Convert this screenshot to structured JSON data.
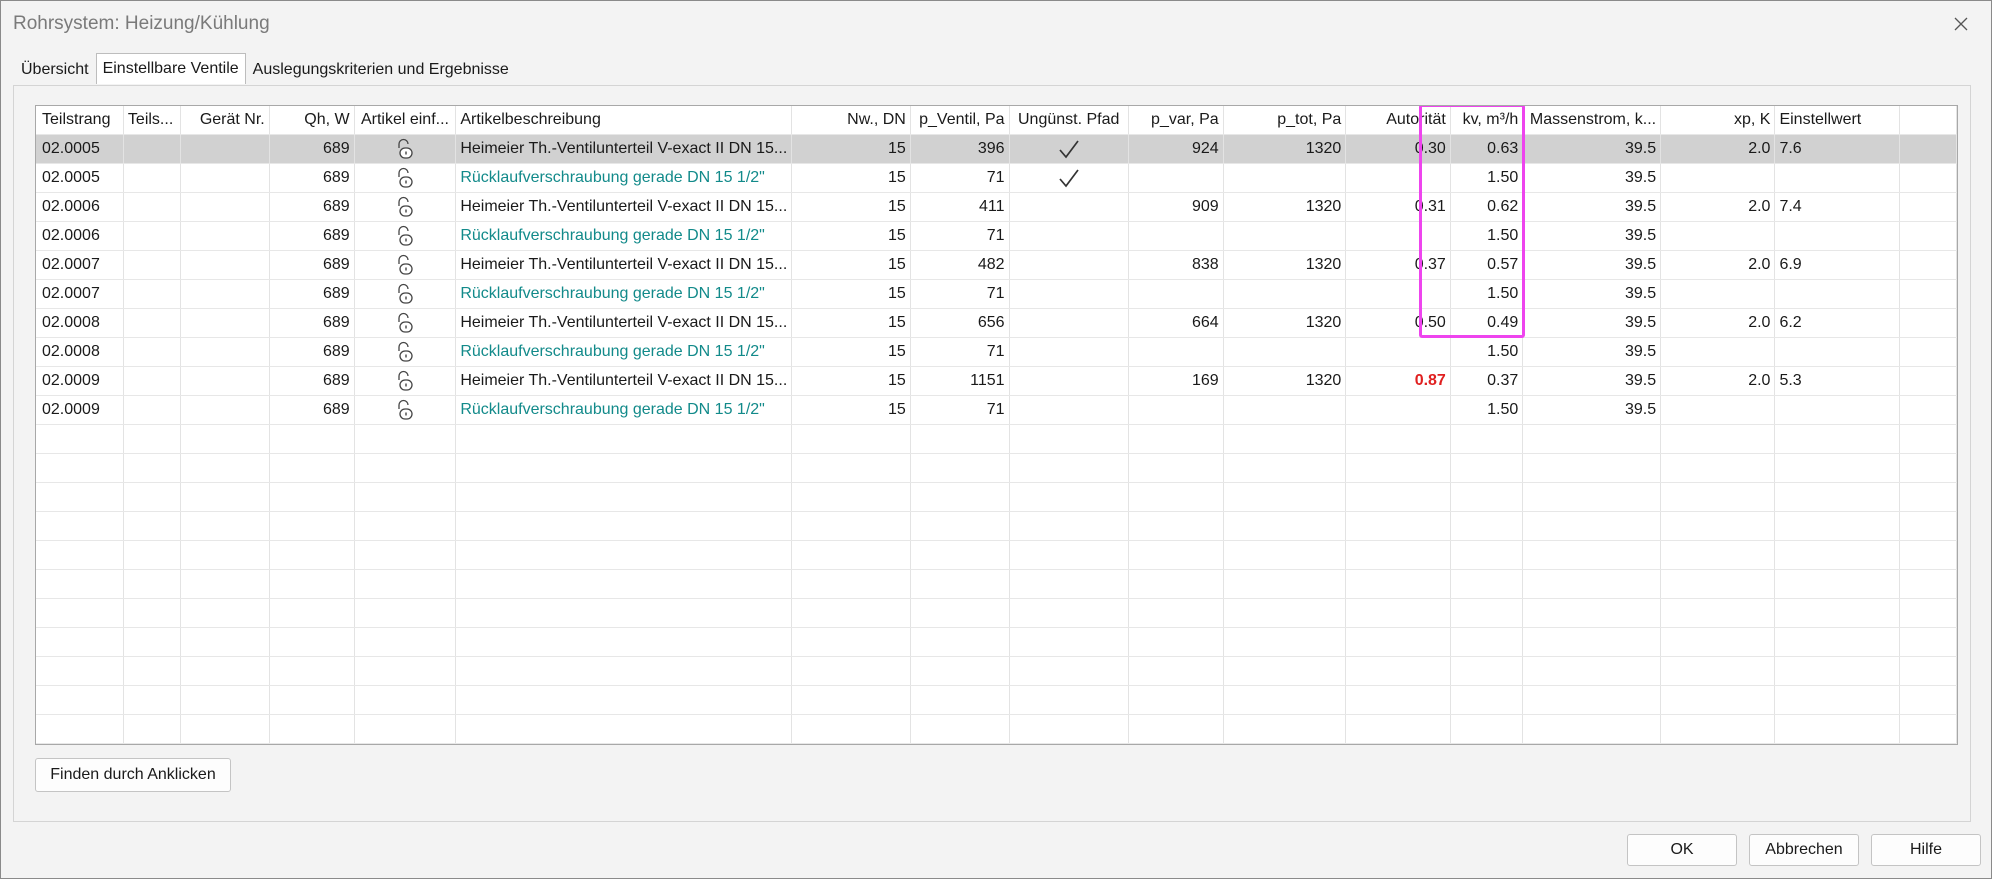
{
  "window": {
    "title": "Rohrsystem: Heizung/Kühlung"
  },
  "tabs": [
    {
      "label": "Übersicht",
      "active": false
    },
    {
      "label": "Einstellbare Ventile",
      "active": true
    },
    {
      "label": "Auslegungskriterien und Ergebnisse",
      "active": false
    }
  ],
  "grid": {
    "columns": [
      "Teilstrang",
      "Teils...",
      "Gerät Nr.",
      "Qh, W",
      "Artikel einf...",
      "Artikelbeschreibung",
      "Nw., DN",
      "p_Ventil, Pa",
      "Ungünst. Pfad",
      "p_var, Pa",
      "p_tot, Pa",
      "Autorität",
      "kv, m³/h",
      "Massenstrom, k...",
      "xp, K",
      "Einstellwert"
    ],
    "rows": [
      {
        "selected": true,
        "teal": false,
        "cells": [
          "02.0005",
          "",
          "",
          "689",
          "lock-icon",
          "Heimeier Th.-Ventilunterteil V-exact II DN 15...",
          "15",
          "396",
          "check",
          "924",
          "1320",
          "0.30",
          "0.63",
          "39.5",
          "2.0",
          "7.6",
          ""
        ]
      },
      {
        "selected": false,
        "teal": true,
        "cells": [
          "02.0005",
          "",
          "",
          "689",
          "lock-icon",
          "Rücklaufverschraubung gerade DN 15 1/2\"",
          "15",
          "71",
          "check",
          "",
          "",
          "",
          "1.50",
          "39.5",
          "",
          "",
          ""
        ]
      },
      {
        "selected": false,
        "teal": false,
        "cells": [
          "02.0006",
          "",
          "",
          "689",
          "lock-icon",
          "Heimeier Th.-Ventilunterteil V-exact II DN 15...",
          "15",
          "411",
          "",
          "909",
          "1320",
          "0.31",
          "0.62",
          "39.5",
          "2.0",
          "7.4",
          ""
        ]
      },
      {
        "selected": false,
        "teal": true,
        "cells": [
          "02.0006",
          "",
          "",
          "689",
          "lock-icon",
          "Rücklaufverschraubung gerade DN 15 1/2\"",
          "15",
          "71",
          "",
          "",
          "",
          "",
          "1.50",
          "39.5",
          "",
          "",
          ""
        ]
      },
      {
        "selected": false,
        "teal": false,
        "cells": [
          "02.0007",
          "",
          "",
          "689",
          "lock-icon",
          "Heimeier Th.-Ventilunterteil V-exact II DN 15...",
          "15",
          "482",
          "",
          "838",
          "1320",
          "0.37",
          "0.57",
          "39.5",
          "2.0",
          "6.9",
          ""
        ]
      },
      {
        "selected": false,
        "teal": true,
        "cells": [
          "02.0007",
          "",
          "",
          "689",
          "lock-icon",
          "Rücklaufverschraubung gerade DN 15 1/2\"",
          "15",
          "71",
          "",
          "",
          "",
          "",
          "1.50",
          "39.5",
          "",
          "",
          ""
        ]
      },
      {
        "selected": false,
        "teal": false,
        "cells": [
          "02.0008",
          "",
          "",
          "689",
          "lock-icon",
          "Heimeier Th.-Ventilunterteil V-exact II DN 15...",
          "15",
          "656",
          "",
          "664",
          "1320",
          "0.50",
          "0.49",
          "39.5",
          "2.0",
          "6.2",
          ""
        ]
      },
      {
        "selected": false,
        "teal": true,
        "cells": [
          "02.0008",
          "",
          "",
          "689",
          "lock-icon",
          "Rücklaufverschraubung gerade DN 15 1/2\"",
          "15",
          "71",
          "",
          "",
          "",
          "",
          "1.50",
          "39.5",
          "",
          "",
          ""
        ]
      },
      {
        "selected": false,
        "teal": false,
        "cells": [
          "02.0009",
          "",
          "",
          "689",
          "lock-icon",
          "Heimeier Th.-Ventilunterteil V-exact II DN 15...",
          "15",
          "1151",
          "",
          "169",
          "1320",
          "0.87",
          "0.37",
          "39.5",
          "2.0",
          "5.3",
          ""
        ]
      },
      {
        "selected": false,
        "teal": true,
        "cells": [
          "02.0009",
          "",
          "",
          "689",
          "lock-icon",
          "Rücklaufverschraubung gerade DN 15 1/2\"",
          "15",
          "71",
          "",
          "",
          "",
          "",
          "1.50",
          "39.5",
          "",
          "",
          ""
        ]
      }
    ],
    "empty_rows": 11,
    "emphasis": {
      "row": 8,
      "col": 11,
      "color": "#e02020"
    },
    "highlight": {
      "column": "Einstellwert",
      "color": "#ee44ee"
    }
  },
  "buttons": {
    "find": "Finden durch Anklicken",
    "ok": "OK",
    "cancel": "Abbrechen",
    "help": "Hilfe"
  },
  "colors": {
    "teal_text": "#128a8a",
    "selected_row": "#d1d1d1"
  }
}
